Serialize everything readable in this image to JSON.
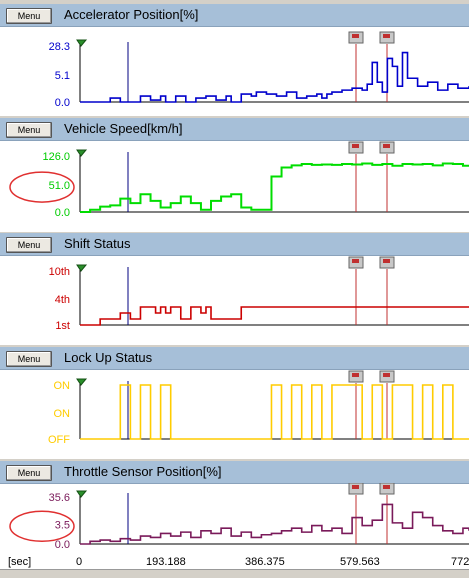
{
  "time_axis": {
    "unit_label": "[sec]",
    "ticks": [
      "0",
      "193.188",
      "386.375",
      "579.563",
      "772"
    ],
    "max": 772
  },
  "panels": [
    {
      "menu_label": "Menu",
      "title": "Accelerator Position[%]",
      "color": "#0000cc",
      "ticks": [
        "28.3",
        "5.1",
        "0.0"
      ],
      "tick_color": "#0000cc",
      "chart_data": {
        "type": "line",
        "ylim": [
          0,
          28.3
        ],
        "x": [
          0,
          20,
          40,
          60,
          80,
          100,
          120,
          140,
          160,
          170,
          190,
          210,
          230,
          250,
          270,
          290,
          300,
          320,
          340,
          350,
          370,
          390,
          410,
          430,
          450,
          470,
          480,
          490,
          500,
          520,
          540,
          560,
          570,
          580,
          590,
          600,
          610,
          620,
          630,
          640,
          650,
          670,
          690,
          710,
          730,
          750,
          772
        ],
        "y": [
          0,
          0,
          0,
          2,
          0,
          0,
          3,
          1,
          3,
          0,
          3,
          0,
          2,
          3,
          1,
          3,
          0,
          4,
          3,
          5,
          4,
          3,
          5,
          2,
          3,
          4,
          2,
          4,
          5,
          6,
          7,
          6,
          9,
          20,
          10,
          5,
          22,
          18,
          8,
          25,
          12,
          8,
          10,
          6,
          9,
          7,
          8
        ]
      }
    },
    {
      "menu_label": "Menu",
      "title": "Vehicle Speed[km/h]",
      "color": "#00dd00",
      "ticks": [
        "126.0",
        "51.0",
        "0.0"
      ],
      "tick_color": "#00cc00",
      "chart_data": {
        "type": "line",
        "ylim": [
          0,
          126
        ],
        "x": [
          0,
          20,
          40,
          60,
          80,
          100,
          120,
          140,
          160,
          180,
          200,
          220,
          240,
          260,
          280,
          300,
          320,
          340,
          360,
          380,
          400,
          420,
          440,
          460,
          480,
          500,
          520,
          540,
          560,
          580,
          600,
          620,
          640,
          660,
          680,
          700,
          720,
          740,
          760,
          772
        ],
        "y": [
          0,
          5,
          12,
          15,
          30,
          20,
          40,
          25,
          10,
          20,
          35,
          20,
          5,
          25,
          35,
          40,
          10,
          5,
          5,
          80,
          100,
          105,
          108,
          106,
          107,
          106,
          108,
          107,
          109,
          106,
          108,
          104,
          108,
          107,
          108,
          105,
          109,
          108,
          104,
          106
        ]
      }
    },
    {
      "menu_label": "Menu",
      "title": "Shift Status",
      "color": "#cc0000",
      "ticks": [
        "10th",
        "4th",
        "1st"
      ],
      "tick_color": "#cc0000",
      "chart_data": {
        "type": "line",
        "ylim": [
          1,
          10
        ],
        "x": [
          0,
          40,
          60,
          80,
          100,
          120,
          140,
          150,
          160,
          170,
          180,
          200,
          220,
          240,
          250,
          260,
          280,
          300,
          320,
          340,
          360,
          380,
          400,
          420,
          440,
          460,
          480,
          500,
          520,
          540,
          560,
          580,
          600,
          620,
          640,
          660,
          680,
          700,
          720,
          740,
          772
        ],
        "y": [
          1,
          2,
          2,
          3,
          2,
          4,
          4,
          3,
          4,
          3,
          4,
          2,
          4,
          3,
          4,
          2,
          2,
          2,
          4,
          4,
          4,
          4,
          4,
          4,
          4,
          4,
          4,
          4,
          4,
          4,
          4,
          4,
          4,
          4,
          4,
          4,
          4,
          4,
          4,
          4,
          4
        ]
      }
    },
    {
      "menu_label": "Menu",
      "title": "Lock Up Status",
      "color": "#ffcc00",
      "ticks": [
        "ON",
        "ON",
        "OFF"
      ],
      "tick_color": "#ffcc00",
      "chart_data": {
        "type": "line",
        "ylim": [
          0,
          1
        ],
        "x": [
          0,
          60,
          80,
          100,
          120,
          140,
          160,
          180,
          200,
          220,
          240,
          260,
          280,
          300,
          320,
          340,
          360,
          380,
          400,
          420,
          440,
          460,
          480,
          500,
          520,
          540,
          560,
          580,
          600,
          620,
          640,
          660,
          680,
          700,
          720,
          740,
          772
        ],
        "y": [
          0,
          0,
          1,
          0,
          1,
          0,
          1,
          0,
          0,
          0,
          0,
          0,
          0,
          0,
          0,
          0,
          0,
          1,
          0,
          1,
          0,
          1,
          0,
          1,
          1,
          1,
          0,
          1,
          0,
          1,
          1,
          0,
          1,
          0,
          1,
          0,
          0
        ]
      }
    },
    {
      "menu_label": "Menu",
      "title": "Throttle Sensor Position[%]",
      "color": "#7a1a5a",
      "ticks": [
        "35.6",
        "3.5",
        "0.0"
      ],
      "tick_color": "#7a1a5a",
      "chart_data": {
        "type": "line",
        "ylim": [
          0,
          35.6
        ],
        "x": [
          0,
          20,
          40,
          60,
          80,
          100,
          120,
          140,
          160,
          180,
          200,
          220,
          240,
          260,
          280,
          300,
          320,
          340,
          360,
          380,
          400,
          420,
          440,
          460,
          480,
          500,
          520,
          540,
          560,
          580,
          600,
          620,
          640,
          660,
          680,
          700,
          720,
          740,
          760,
          772
        ],
        "y": [
          0,
          2,
          3,
          2,
          4,
          3,
          6,
          5,
          8,
          6,
          9,
          5,
          10,
          8,
          12,
          6,
          9,
          5,
          7,
          8,
          10,
          12,
          9,
          14,
          10,
          12,
          8,
          20,
          14,
          18,
          30,
          16,
          12,
          24,
          20,
          14,
          10,
          8,
          12,
          10
        ]
      }
    }
  ],
  "annotations": {
    "circle_color": "#e03030",
    "circled_ticks": [
      "51.0",
      "3.5"
    ]
  }
}
